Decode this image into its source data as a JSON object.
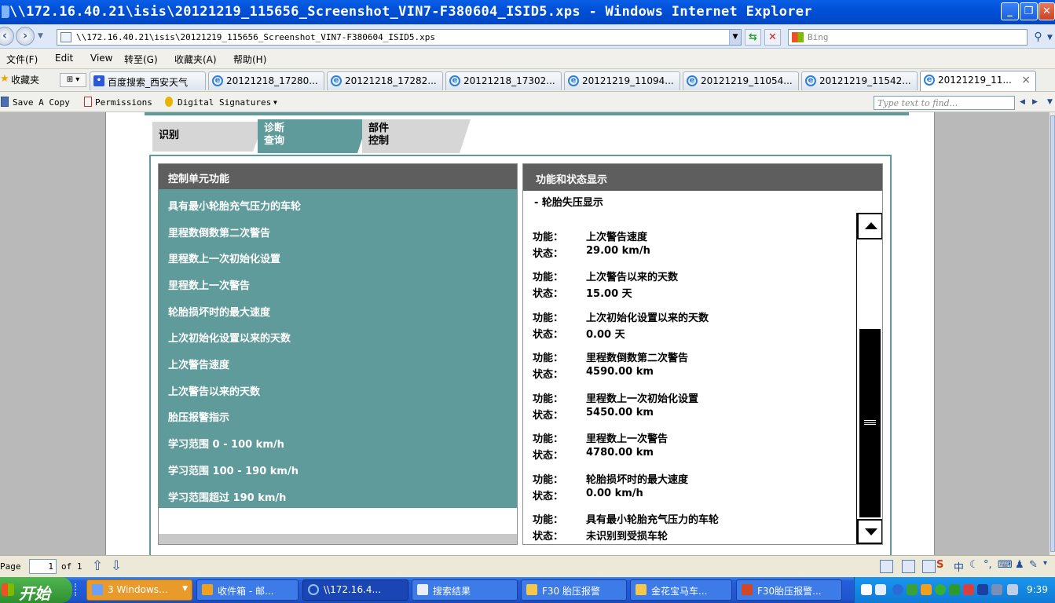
{
  "window": {
    "title": "\\\\172.16.40.21\\isis\\20121219_115656_Screenshot_VIN7-F380604_ISID5.xps - Windows Internet Explorer"
  },
  "address": {
    "url": "\\\\172.16.40.21\\isis\\20121219_115656_Screenshot_VIN7-F380604_ISID5.xps",
    "search_placeholder": "Bing"
  },
  "menu": [
    "文件(F)",
    "Edit",
    "View",
    "转至(G)",
    "收藏夹(A)",
    "帮助(H)"
  ],
  "favorites": {
    "label": "收藏夹",
    "tabs": [
      {
        "label": "百度搜索_西安天气"
      },
      {
        "label": "20121218_17280..."
      },
      {
        "label": "20121218_17282..."
      },
      {
        "label": "20121218_17302..."
      },
      {
        "label": "20121219_11094..."
      },
      {
        "label": "20121219_11054..."
      },
      {
        "label": "20121219_11542..."
      },
      {
        "label": "20121219_11..."
      }
    ]
  },
  "xps_toolbar": {
    "save": "Save A Copy",
    "permissions": "Permissions",
    "signatures": "Digital Signatures",
    "find_placeholder": "Type text to find..."
  },
  "app": {
    "tabs": [
      {
        "label_line1": "识别",
        "label_line2": ""
      },
      {
        "label_line1": "诊断",
        "label_line2": "查询"
      },
      {
        "label_line1": "部件",
        "label_line2": "控制"
      }
    ],
    "left_panel": {
      "title": "控制单元功能",
      "items": [
        "具有最小轮胎充气压力的车轮",
        "里程数倒数第二次警告",
        "里程数上一次初始化设置",
        "里程数上一次警告",
        "轮胎损坏时的最大速度",
        "上次初始化设置以来的天数",
        "上次警告速度",
        "上次警告以来的天数",
        "胎压报警指示",
        "学习范围 0 - 100 km/h",
        "学习范围 100 - 190 km/h",
        "学习范围超过 190 km/h"
      ]
    },
    "right_panel": {
      "title": "功能和状态显示",
      "subtitle": "- 轮胎失压显示",
      "func_label": "功能：",
      "state_label": "状态：",
      "entries": [
        {
          "func": "上次警告速度",
          "state": "29.00 km/h"
        },
        {
          "func": "上次警告以来的天数",
          "state": "15.00 天"
        },
        {
          "func": "上次初始化设置以来的天数",
          "state": "0.00 天"
        },
        {
          "func": "里程数倒数第二次警告",
          "state": "4590.00 km"
        },
        {
          "func": "里程数上一次初始化设置",
          "state": "5450.00 km"
        },
        {
          "func": "里程数上一次警告",
          "state": "4780.00 km"
        },
        {
          "func": "轮胎损坏时的最大速度",
          "state": "0.00 km/h"
        },
        {
          "func": "具有最小轮胎充气压力的车轮",
          "state": "未识别到受损车轮"
        }
      ]
    }
  },
  "statusbar": {
    "page_label": "Page",
    "page_value": "1",
    "page_of": "of 1"
  },
  "taskbar": {
    "start": "开始",
    "tasks": [
      {
        "label": "3 Windows..."
      },
      {
        "label": "收件箱 - 邮..."
      },
      {
        "label": "\\\\172.16.4..."
      },
      {
        "label": "搜索结果"
      },
      {
        "label": "F30 胎压报警"
      },
      {
        "label": "金花宝马车..."
      },
      {
        "label": "F30胎压报警..."
      }
    ],
    "clock": "9:39"
  }
}
